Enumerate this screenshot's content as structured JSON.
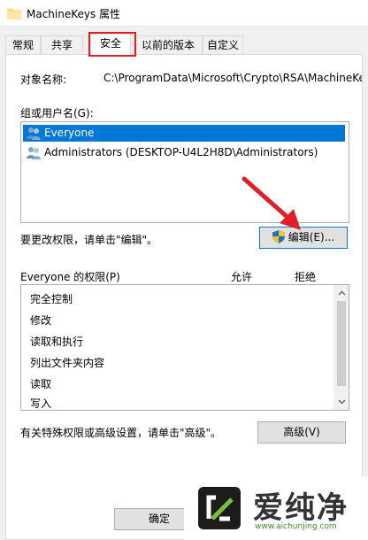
{
  "window": {
    "title": "MachineKeys 属性"
  },
  "tabs": [
    {
      "label": "常规"
    },
    {
      "label": "共享"
    },
    {
      "label": "安全"
    },
    {
      "label": "以前的版本"
    },
    {
      "label": "自定义"
    }
  ],
  "active_tab": "安全",
  "object": {
    "label": "对象名称:",
    "value": "C:\\ProgramData\\Microsoft\\Crypto\\RSA\\MachineKeys"
  },
  "groups": {
    "label": "组或用户名(G):",
    "items": [
      {
        "name": "Everyone",
        "selected": true
      },
      {
        "name": "Administrators (DESKTOP-U4L2H8D\\Administrators)",
        "selected": false
      }
    ]
  },
  "edit_hint": "要更改权限，请单击\"编辑\"。",
  "edit_button": "编辑(E)...",
  "permissions": {
    "header": "Everyone 的权限(P)",
    "allow": "允许",
    "deny": "拒绝",
    "items": [
      "完全控制",
      "修改",
      "读取和执行",
      "列出文件夹内容",
      "读取",
      "写入"
    ]
  },
  "advanced_hint": "有关特殊权限或高级设置，请单击\"高级\"。",
  "advanced_button": "高级(V)",
  "ok_button": "确定",
  "watermark": {
    "name": "爱纯净",
    "url": "www.aichunjing.com"
  },
  "colors": {
    "selection": "#0078d7",
    "highlight_red": "#e21f26"
  },
  "icons": [
    "folder-icon",
    "users-icon",
    "shield-icon",
    "scroll-up-icon",
    "scroll-down-icon",
    "red-arrow-annotation"
  ]
}
